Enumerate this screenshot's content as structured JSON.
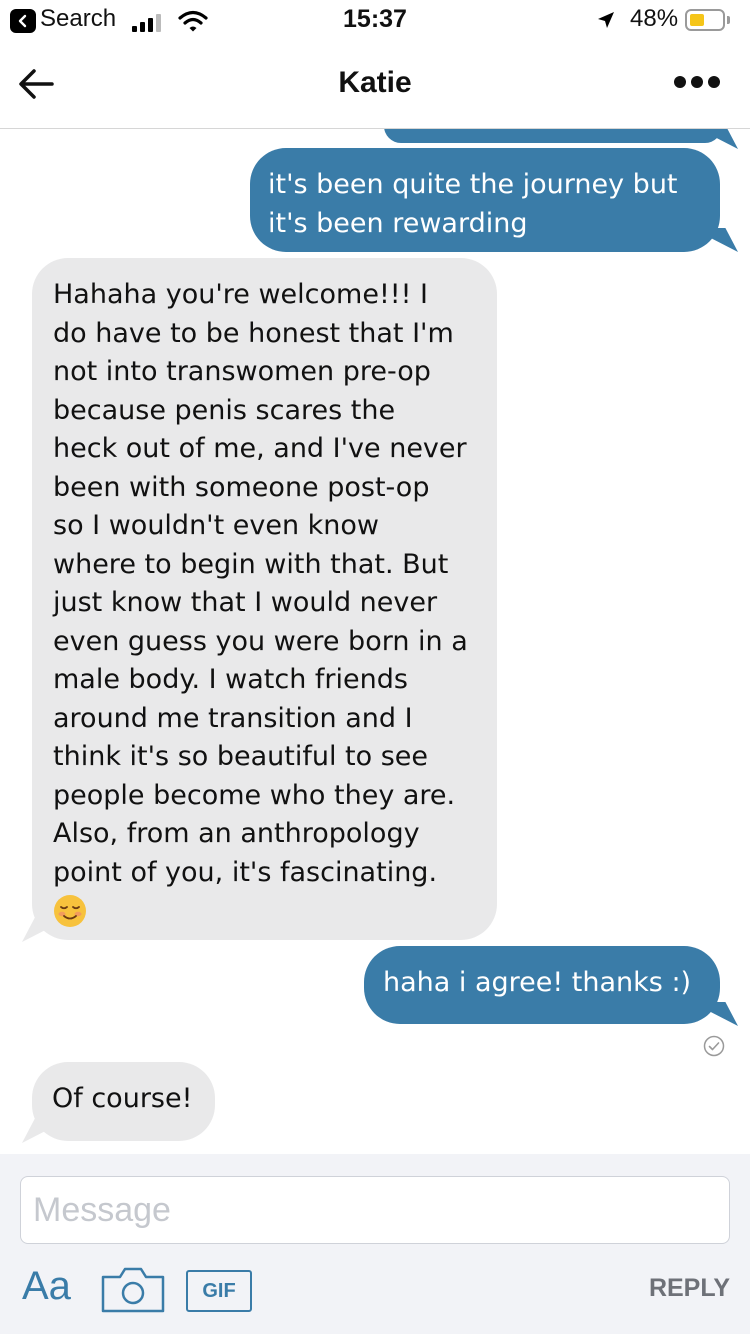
{
  "status_bar": {
    "back_app_label": "Search",
    "time": "15:37",
    "battery_percent_label": "48%",
    "battery_level": 0.48,
    "battery_color": "#f5c518",
    "icons": [
      "back-arrow-icon",
      "cellular-signal-icon",
      "wifi-icon",
      "location-arrow-icon",
      "battery-icon"
    ]
  },
  "header": {
    "title": "Katie",
    "back_icon": "arrow-left-icon",
    "more_icon": "more-dots-icon"
  },
  "messages": [
    {
      "sender": "me",
      "text": "it's been quite the journey but\nit's been rewarding"
    },
    {
      "sender": "Katie",
      "text": "Hahaha you're welcome!!! I\ndo have to be honest that I'm\nnot into transwomen pre-op\nbecause penis scares the\nheck out of me, and I've never\nbeen with someone post-op\nso I wouldn't even know\nwhere to begin with that. But\njust know that I would never\neven guess you were born in a\nmale body. I watch friends\naround me transition and I\nthink it's so beautiful to see\npeople become who they are.\nAlso, from an anthropology\npoint of you, it's fascinating.",
      "emoji": "smiling-face-icon"
    },
    {
      "sender": "me",
      "text": "haha i agree! thanks :)",
      "receipt_icon": "read-check-icon"
    },
    {
      "sender": "Katie",
      "text": "Of course!"
    }
  ],
  "composer": {
    "placeholder": "Message",
    "value": "",
    "format_label": "Aa",
    "camera_icon": "camera-icon",
    "gif_label": "GIF",
    "reply_label": "REPLY"
  },
  "colors": {
    "outgoing_bubble": "#3a7ca8",
    "incoming_bubble": "#e9e9ea",
    "accent": "#3a7ca8",
    "composer_bg": "#f2f3f7"
  }
}
